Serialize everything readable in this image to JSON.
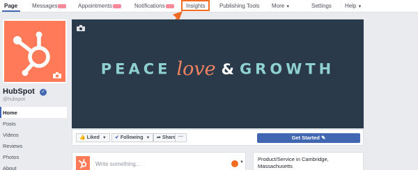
{
  "topnav": {
    "items": [
      {
        "label": "Page"
      },
      {
        "label": "Messages"
      },
      {
        "label": "Appointments"
      },
      {
        "label": "Notifications"
      },
      {
        "label": "Insights"
      },
      {
        "label": "Publishing Tools"
      },
      {
        "label": "More"
      },
      {
        "label": "Settings"
      },
      {
        "label": "Help"
      }
    ]
  },
  "profile": {
    "name": "HubSpot",
    "handle": "@hubspot"
  },
  "sidebar": {
    "items": [
      {
        "label": "Home"
      },
      {
        "label": "Posts"
      },
      {
        "label": "Videos"
      },
      {
        "label": "Reviews"
      },
      {
        "label": "Photos"
      },
      {
        "label": "About"
      }
    ]
  },
  "cover": {
    "word1": "PEACE",
    "word2": "love",
    "word3": "&",
    "word4": "GROWTH"
  },
  "actions": {
    "liked": "Liked",
    "following": "Following",
    "share": "Share",
    "more": "···",
    "get_started": "Get Started"
  },
  "composer": {
    "placeholder": "Write something..."
  },
  "info": {
    "line1": "Product/Service in Cambridge,",
    "line2": "Massachusetts"
  },
  "colors": {
    "brand": "#ff7a59",
    "facebook_blue": "#4267b2",
    "cover_bg": "#2b3a4a",
    "highlight": "#f36b21"
  },
  "icons": [
    "camera-icon",
    "thumbs-up-icon",
    "rss-icon",
    "share-arrow-icon",
    "pencil-icon",
    "emoji-icon",
    "hubspot-sprocket-icon",
    "verified-check-icon"
  ]
}
